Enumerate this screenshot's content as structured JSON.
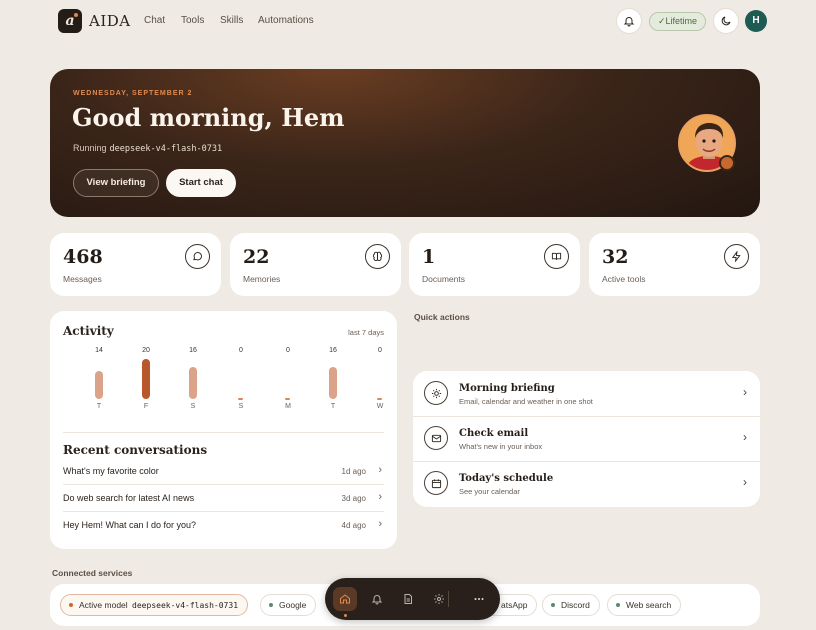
{
  "nav": {
    "brand": "AIDA",
    "logo_letter": "a",
    "links": [
      "Chat",
      "Tools",
      "Skills",
      "Automations"
    ],
    "badge": "✓Lifetime",
    "user_initial": "H"
  },
  "hero": {
    "date": "WEDNESDAY, SEPTEMBER 2",
    "greeting": "Good morning, Hem",
    "running_label": "Running",
    "model": "deepseek-v4-flash-0731",
    "primary_button": "View briefing",
    "secondary_button": "Start chat"
  },
  "stats": [
    {
      "value": "468",
      "label": "Messages",
      "icon": "chat-bubble-icon"
    },
    {
      "value": "22",
      "label": "Memories",
      "icon": "brain-icon"
    },
    {
      "value": "1",
      "label": "Documents",
      "icon": "book-icon"
    },
    {
      "value": "32",
      "label": "Active tools",
      "icon": "lightning-icon"
    }
  ],
  "activity": {
    "title": "Activity",
    "range": "last 7 days",
    "days": [
      {
        "day": "T",
        "count": "14"
      },
      {
        "day": "F",
        "count": "20"
      },
      {
        "day": "S",
        "count": "16"
      },
      {
        "day": "S",
        "count": "0"
      },
      {
        "day": "M",
        "count": "0"
      },
      {
        "day": "T",
        "count": "16"
      },
      {
        "day": "W",
        "count": "0"
      }
    ]
  },
  "recent": {
    "title": "Recent conversations",
    "items": [
      {
        "text": "What's my favorite color",
        "time": "1d ago"
      },
      {
        "text": "Do web search for latest AI news",
        "time": "3d ago"
      },
      {
        "text": "Hey Hem! What can I do for you?",
        "time": "4d ago"
      }
    ]
  },
  "quick_actions": {
    "label": "Quick actions",
    "items": [
      {
        "title": "Morning briefing",
        "subtitle": "Email, calendar and weather in one shot",
        "icon": "sun-icon"
      },
      {
        "title": "Check email",
        "subtitle": "What's new in your inbox",
        "icon": "mail-icon"
      },
      {
        "title": "Today's schedule",
        "subtitle": "See your calendar",
        "icon": "calendar-icon"
      }
    ]
  },
  "services": {
    "label": "Connected services",
    "active_model_label": "Active model",
    "active_model": "deepseek-v4-flash-0731",
    "items": [
      "Google",
      "atsApp",
      "Discord",
      "Web search"
    ]
  },
  "colors": {
    "accent": "#c9692e",
    "background": "#efebe4",
    "hero_dark": "#231711",
    "bar_high": "#b8582b",
    "bar_normal": "#dba48a",
    "status_green": "#5d8a68"
  }
}
